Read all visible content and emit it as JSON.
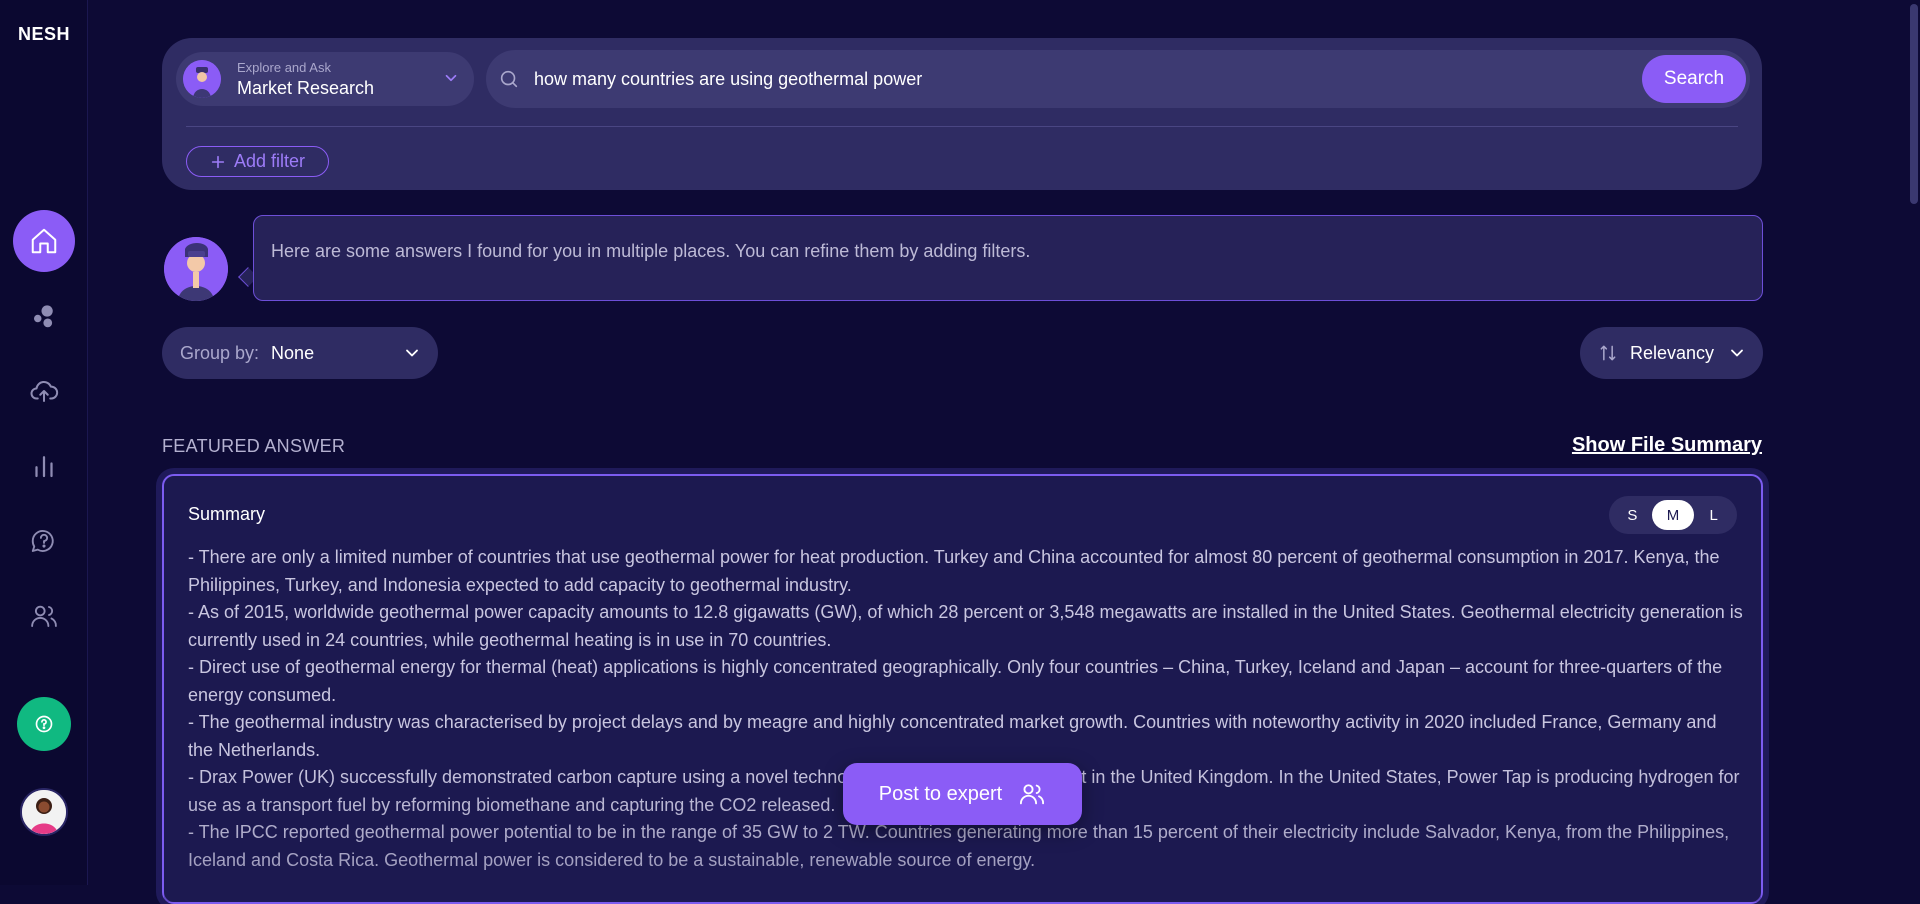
{
  "app": {
    "logo": "NESH"
  },
  "sidebar": {
    "items": [
      {
        "name": "home",
        "icon": "home-icon",
        "active": true
      },
      {
        "name": "bubbles",
        "icon": "bubbles-icon",
        "active": false
      },
      {
        "name": "upload",
        "icon": "cloud-upload-icon",
        "active": false
      },
      {
        "name": "analytics",
        "icon": "bar-chart-icon",
        "active": false
      },
      {
        "name": "questions",
        "icon": "question-chat-icon",
        "active": false
      },
      {
        "name": "team",
        "icon": "users-icon",
        "active": false
      }
    ],
    "help_icon": "help-circle-icon",
    "accent": "#8b5cf6",
    "help_color": "#10b981"
  },
  "search": {
    "kb_small_label": "Explore and Ask",
    "kb_selected": "Market Research",
    "query": "how many countries are using geothermal power",
    "search_button": "Search",
    "add_filter": "Add filter"
  },
  "assistant": {
    "message": "Here are some answers I found for you in multiple places. You can refine them by adding filters."
  },
  "controls": {
    "group_by_label": "Group by:",
    "group_by_value": "None",
    "sort_value": "Relevancy"
  },
  "featured": {
    "label": "FEATURED ANSWER",
    "show_summary": "Show File Summary",
    "summary_title": "Summary",
    "sizes": [
      "S",
      "M",
      "L"
    ],
    "active_size": "M",
    "lines": [
      "- There are only a limited number of countries that use geothermal power for heat production. Turkey and China accounted for almost 80 percent of geothermal consumption in 2017. Kenya, the Philippines, Turkey, and Indonesia expected to add capacity to geothermal industry.",
      "- As of 2015, worldwide geothermal power capacity amounts to 12.8 gigawatts (GW), of which 28 percent or 3,548 megawatts are installed in the United States. Geothermal electricity generation is currently used in 24 countries, while geothermal heating is in use in 70 countries.",
      "- Direct use of geothermal energy for thermal (heat) applications is highly concentrated geographically. Only four countries – China, Turkey, Iceland and Japan – account for three-quarters of the energy consumed.",
      "- The geothermal industry was characterised by project delays and by meagre and highly concentrated market growth. Countries with noteworthy activity in 2020 included France, Germany and the Netherlands.",
      "- Drax Power (UK) successfully demonstrated carbon capture using a novel technology at a biomass-power plant in the United Kingdom. In the United States, Power Tap is producing hydrogen for use as a transport fuel by reforming biomethane and capturing the CO2 released.",
      "- The IPCC reported geothermal power potential to be in the range of 35 GW to 2 TW. Countries generating more than 15 percent of their electricity include Salvador, Kenya, from the Philippines, Iceland and Costa Rica. Geothermal power is considered to be a sustainable, renewable source of energy."
    ]
  },
  "post_expert": {
    "label": "Post to expert",
    "icon": "users-icon"
  }
}
